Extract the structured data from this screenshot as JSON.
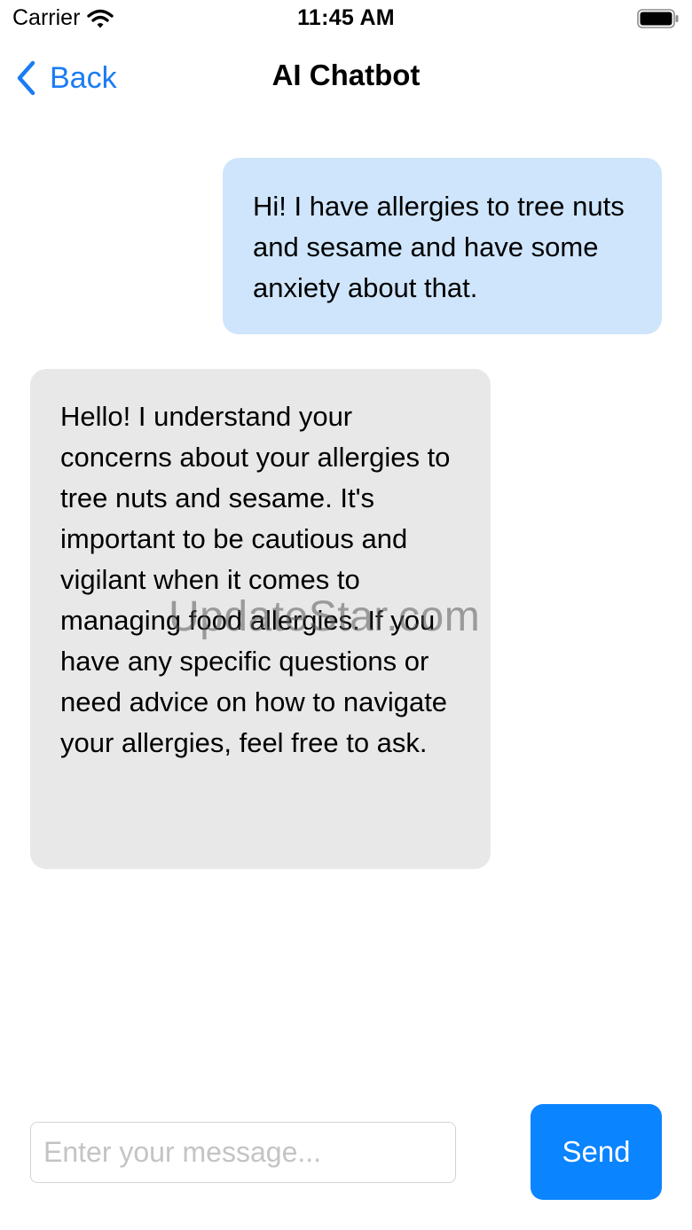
{
  "status_bar": {
    "carrier": "Carrier",
    "time": "11:45 AM",
    "icons": [
      "wifi-icon",
      "battery-icon"
    ]
  },
  "nav": {
    "back_label": "Back",
    "title": "AI Chatbot",
    "back_icon": "chevron-left-icon"
  },
  "messages": [
    {
      "sender": "user",
      "text": "Hi! I have allergies to tree nuts and sesame and have some anxiety about that."
    },
    {
      "sender": "bot",
      "text": "Hello! I understand your concerns about your allergies to tree nuts and sesame. It's important to be cautious and vigilant when it comes to managing food allergies. If you have any specific questions or need advice on how to navigate your allergies, feel free to ask."
    }
  ],
  "watermark": "UpdateStar.com",
  "composer": {
    "placeholder": "Enter your message...",
    "value": "",
    "send_label": "Send"
  },
  "colors": {
    "accent": "#0a84ff",
    "user_bubble": "#cfe5fb",
    "bot_bubble": "#e8e8e8"
  }
}
